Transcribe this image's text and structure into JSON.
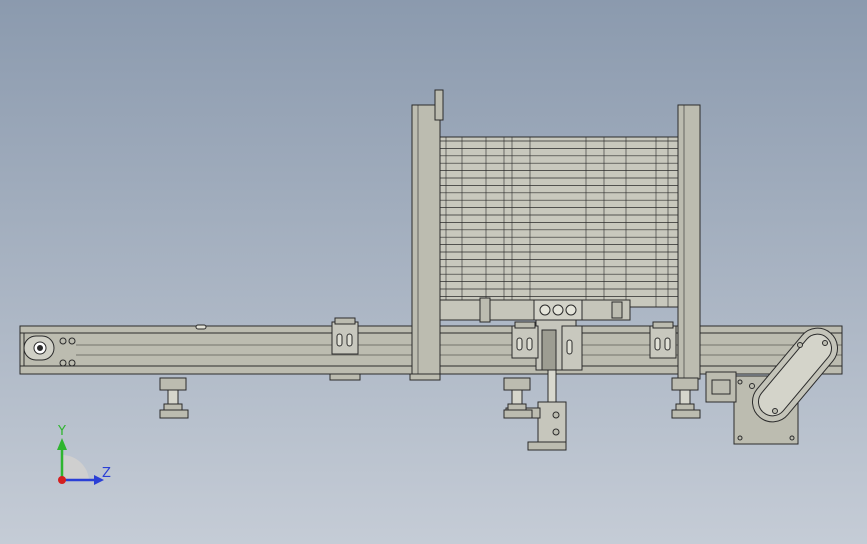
{
  "viewport": {
    "background_top": "#8b9aae",
    "background_bottom": "#c5ccd6"
  },
  "model": {
    "part_fill": "#bcbcb0",
    "part_stroke": "#2b2b2b",
    "shade_fill": "#a9a99e"
  },
  "triad": {
    "y_label": "Y",
    "z_label": "Z",
    "y_color": "#2fb52f",
    "z_color": "#2a3fd6",
    "x_color": "#d42020"
  }
}
